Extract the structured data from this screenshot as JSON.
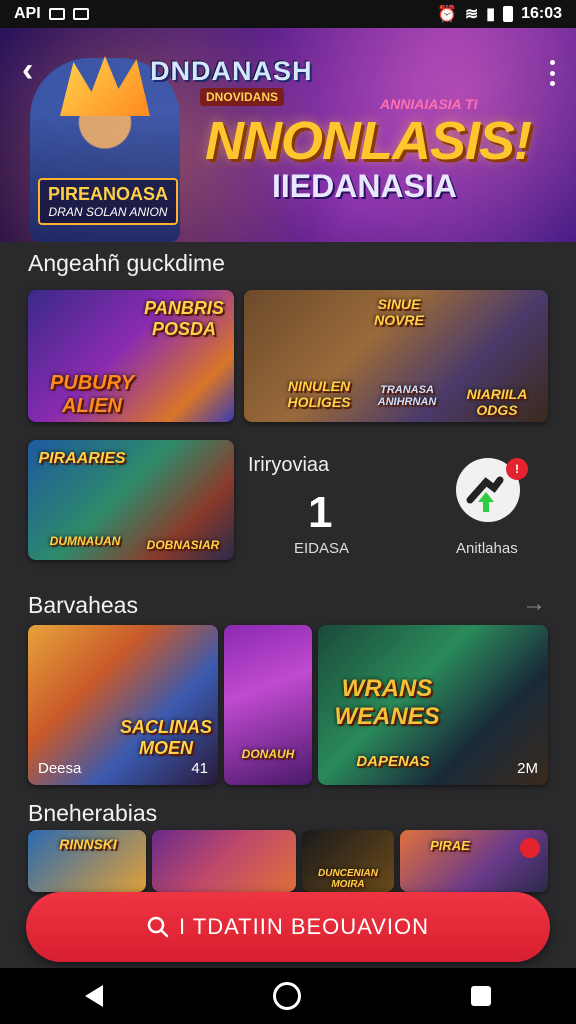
{
  "status_bar": {
    "left_text": "API",
    "time": "16:03"
  },
  "hero": {
    "logo": "DNDANASH",
    "logo_sub": "DNOVIDANS",
    "tag": "ANNIAIASIA TI",
    "title": "NNONLASIS!",
    "subtitle": "IIEDANASIA",
    "badge_title": "PIREANOASA",
    "badge_sub": "DRAN SOLAN ANION"
  },
  "sections": {
    "first": {
      "title": "Angeahñ guckdime",
      "cards": [
        {
          "title": "PANBRIS POSDA",
          "sub": "PUBURY ALIEN"
        },
        {
          "title": "SINUE NOVRE",
          "sub": "NINULEN HOLIGES",
          "sub2": "TRANASA ANIHRNAN",
          "corner": "NIARIILA ODGS"
        },
        {
          "title": "PIRAARIES",
          "sub": "DUMNAUAN",
          "sub2": "DOBNASIAR"
        }
      ]
    },
    "stats": {
      "label": "Iriryoviaa",
      "count": "1",
      "count_sub": "EIDASA",
      "download_sub": "Anitlahas",
      "badge": "!"
    },
    "second": {
      "title": "Barvaheas",
      "cards": [
        {
          "title": "SACLINAS MOEN",
          "caption": "Deesa",
          "count": "41"
        },
        {
          "title": "DONAUH"
        },
        {
          "title": "WRANS WEANES",
          "sub": "DAPENAS",
          "count": "2M"
        }
      ]
    },
    "third": {
      "title": "Bneherabias",
      "cards": [
        {
          "title": "RINNSKI"
        },
        {
          "title": ""
        },
        {
          "title": "DUNCENIAN MOIRA"
        },
        {
          "title": "PIRAE"
        }
      ]
    }
  },
  "cta": {
    "label": "I TDATIIN BEOUAVION"
  },
  "colors": {
    "accent": "#e3242f",
    "background": "#2a2a2d"
  }
}
